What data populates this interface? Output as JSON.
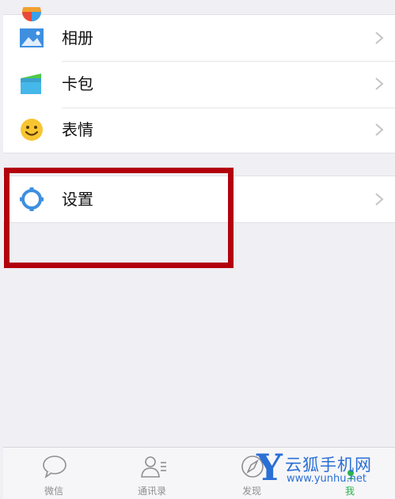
{
  "menu": {
    "items": [
      {
        "label": "相册",
        "icon": "photo-album-icon"
      },
      {
        "label": "卡包",
        "icon": "card-wallet-icon"
      },
      {
        "label": "表情",
        "icon": "smiley-icon"
      }
    ],
    "settings": {
      "label": "设置",
      "icon": "gear-icon"
    }
  },
  "tabbar": {
    "tabs": [
      {
        "label": "微信",
        "icon": "chat-bubble-icon"
      },
      {
        "label": "通讯录",
        "icon": "contacts-icon"
      },
      {
        "label": "发现",
        "icon": "compass-icon"
      },
      {
        "label": "我",
        "icon": "profile-icon",
        "active": true
      }
    ]
  },
  "watermark": {
    "letter": "Y",
    "name": "云狐手机网",
    "url": "www.yunhu.net"
  },
  "colors": {
    "accent_green": "#2bb24c",
    "highlight_red": "#b3000d",
    "settings_blue": "#3d8fe0"
  }
}
